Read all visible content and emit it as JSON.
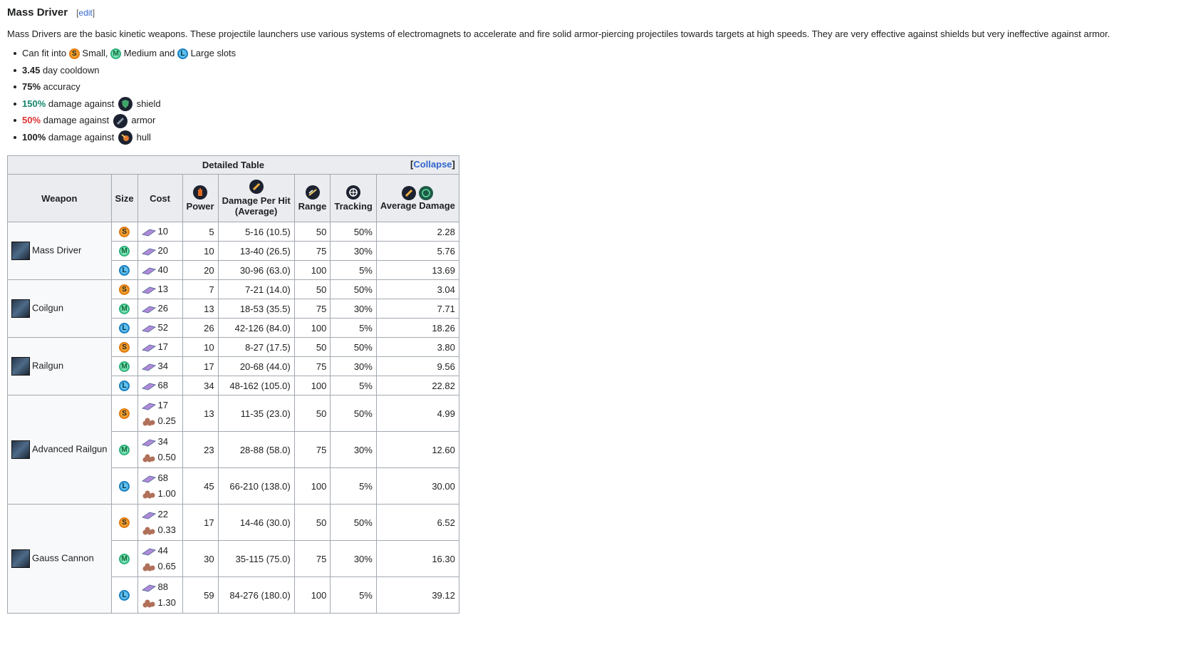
{
  "section": {
    "title": "Mass Driver",
    "edit_label": "edit"
  },
  "description": "Mass Drivers are the basic kinetic weapons. These projectile launchers use various systems of electromagnets to accelerate and fire solid armor-piercing projectiles towards targets at high speeds. They are very effective against shields but very ineffective against armor.",
  "facts": {
    "fit_prefix": "Can fit into",
    "small": "Small,",
    "medium": "Medium and",
    "large": "Large slots",
    "cooldown_value": "3.45",
    "cooldown_text": "day cooldown",
    "accuracy_value": "75%",
    "accuracy_text": "accuracy",
    "shield_value": "150%",
    "armor_value": "50%",
    "hull_value": "100%",
    "damage_against": "damage against",
    "shield": "shield",
    "armor": "armor",
    "hull": "hull"
  },
  "badges": {
    "s": "S",
    "m": "M",
    "l": "L"
  },
  "table": {
    "caption": "Detailed Table",
    "collapse_label": "Collapse",
    "headers": {
      "weapon": "Weapon",
      "size": "Size",
      "cost": "Cost",
      "power": "Power",
      "damage_line1": "Damage Per Hit",
      "damage_line2": "(Average)",
      "range": "Range",
      "tracking": "Tracking",
      "avg_damage": "Average Damage"
    },
    "groups": [
      {
        "name": "Mass Driver",
        "rows": [
          {
            "size": "S",
            "cost": [
              "10"
            ],
            "power": "5",
            "dph": "5-16 (10.5)",
            "range": "50",
            "tracking": "50%",
            "avg": "2.28"
          },
          {
            "size": "M",
            "cost": [
              "20"
            ],
            "power": "10",
            "dph": "13-40 (26.5)",
            "range": "75",
            "tracking": "30%",
            "avg": "5.76"
          },
          {
            "size": "L",
            "cost": [
              "40"
            ],
            "power": "20",
            "dph": "30-96 (63.0)",
            "range": "100",
            "tracking": "5%",
            "avg": "13.69"
          }
        ]
      },
      {
        "name": "Coilgun",
        "rows": [
          {
            "size": "S",
            "cost": [
              "13"
            ],
            "power": "7",
            "dph": "7-21 (14.0)",
            "range": "50",
            "tracking": "50%",
            "avg": "3.04"
          },
          {
            "size": "M",
            "cost": [
              "26"
            ],
            "power": "13",
            "dph": "18-53 (35.5)",
            "range": "75",
            "tracking": "30%",
            "avg": "7.71"
          },
          {
            "size": "L",
            "cost": [
              "52"
            ],
            "power": "26",
            "dph": "42-126 (84.0)",
            "range": "100",
            "tracking": "5%",
            "avg": "18.26"
          }
        ]
      },
      {
        "name": "Railgun",
        "rows": [
          {
            "size": "S",
            "cost": [
              "17"
            ],
            "power": "10",
            "dph": "8-27 (17.5)",
            "range": "50",
            "tracking": "50%",
            "avg": "3.80"
          },
          {
            "size": "M",
            "cost": [
              "34"
            ],
            "power": "17",
            "dph": "20-68 (44.0)",
            "range": "75",
            "tracking": "30%",
            "avg": "9.56"
          },
          {
            "size": "L",
            "cost": [
              "68"
            ],
            "power": "34",
            "dph": "48-162 (105.0)",
            "range": "100",
            "tracking": "5%",
            "avg": "22.82"
          }
        ]
      },
      {
        "name": "Advanced Railgun",
        "rows": [
          {
            "size": "S",
            "cost": [
              "17",
              "0.25"
            ],
            "power": "13",
            "dph": "11-35 (23.0)",
            "range": "50",
            "tracking": "50%",
            "avg": "4.99"
          },
          {
            "size": "M",
            "cost": [
              "34",
              "0.50"
            ],
            "power": "23",
            "dph": "28-88 (58.0)",
            "range": "75",
            "tracking": "30%",
            "avg": "12.60"
          },
          {
            "size": "L",
            "cost": [
              "68",
              "1.00"
            ],
            "power": "45",
            "dph": "66-210 (138.0)",
            "range": "100",
            "tracking": "5%",
            "avg": "30.00"
          }
        ]
      },
      {
        "name": "Gauss Cannon",
        "rows": [
          {
            "size": "S",
            "cost": [
              "22",
              "0.33"
            ],
            "power": "17",
            "dph": "14-46 (30.0)",
            "range": "50",
            "tracking": "50%",
            "avg": "6.52"
          },
          {
            "size": "M",
            "cost": [
              "44",
              "0.65"
            ],
            "power": "30",
            "dph": "35-115 (75.0)",
            "range": "75",
            "tracking": "30%",
            "avg": "16.30"
          },
          {
            "size": "L",
            "cost": [
              "88",
              "1.30"
            ],
            "power": "59",
            "dph": "84-276 (180.0)",
            "range": "100",
            "tracking": "5%",
            "avg": "39.12"
          }
        ]
      }
    ]
  }
}
